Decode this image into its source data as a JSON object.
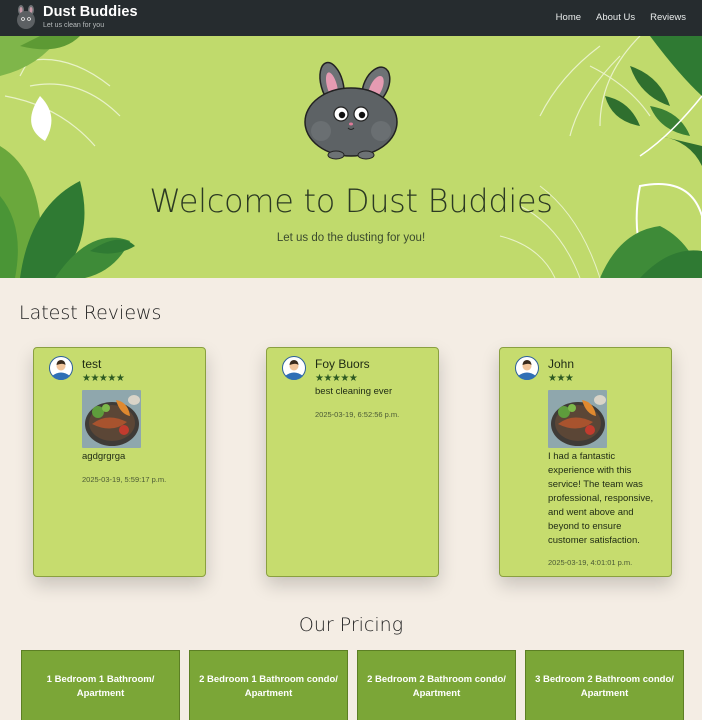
{
  "brand": {
    "title": "Dust Buddies",
    "tagline": "Let us clean for you"
  },
  "nav": {
    "items": [
      {
        "label": "Home"
      },
      {
        "label": "About Us"
      },
      {
        "label": "Reviews"
      }
    ]
  },
  "hero": {
    "title": "Welcome to Dust Buddies",
    "subtitle": "Let us do the dusting for you!"
  },
  "reviews": {
    "heading": "Latest Reviews",
    "items": [
      {
        "name": "test",
        "rating": 5,
        "stars": "★★★★★",
        "has_image": true,
        "text": "agdgrgrga",
        "date": "2025-03-19, 5:59:17 p.m."
      },
      {
        "name": "Foy Buors",
        "rating": 5,
        "stars": "★★★★★",
        "has_image": false,
        "text": "best cleaning ever",
        "date": "2025-03-19, 6:52:56 p.m."
      },
      {
        "name": "John",
        "rating": 3,
        "stars": "★★★",
        "has_image": true,
        "text": "I had a fantastic experience with this service! The team was professional, responsive, and went above and beyond to ensure customer satisfaction.",
        "date": "2025-03-19, 4:01:01 p.m."
      }
    ]
  },
  "pricing": {
    "heading": "Our Pricing",
    "plans": [
      {
        "title": "1 Bedroom 1 Bathroom/ Apartment"
      },
      {
        "title": "2 Bedroom 1 Bathroom condo/ Apartment"
      },
      {
        "title": "2 Bedroom 2 Bathroom condo/ Apartment"
      },
      {
        "title": "3 Bedroom 2 Bathroom condo/ Apartment"
      }
    ]
  },
  "colors": {
    "navbar": "#262c2f",
    "hero": "#c0da6c",
    "card": "#c6dc6e",
    "pricing_card": "#7ba637",
    "background": "#f4ede4"
  },
  "icons": {
    "logo": "dust-bunny-logo-icon",
    "avatar": "user-avatar-icon",
    "star": "star-icon"
  }
}
